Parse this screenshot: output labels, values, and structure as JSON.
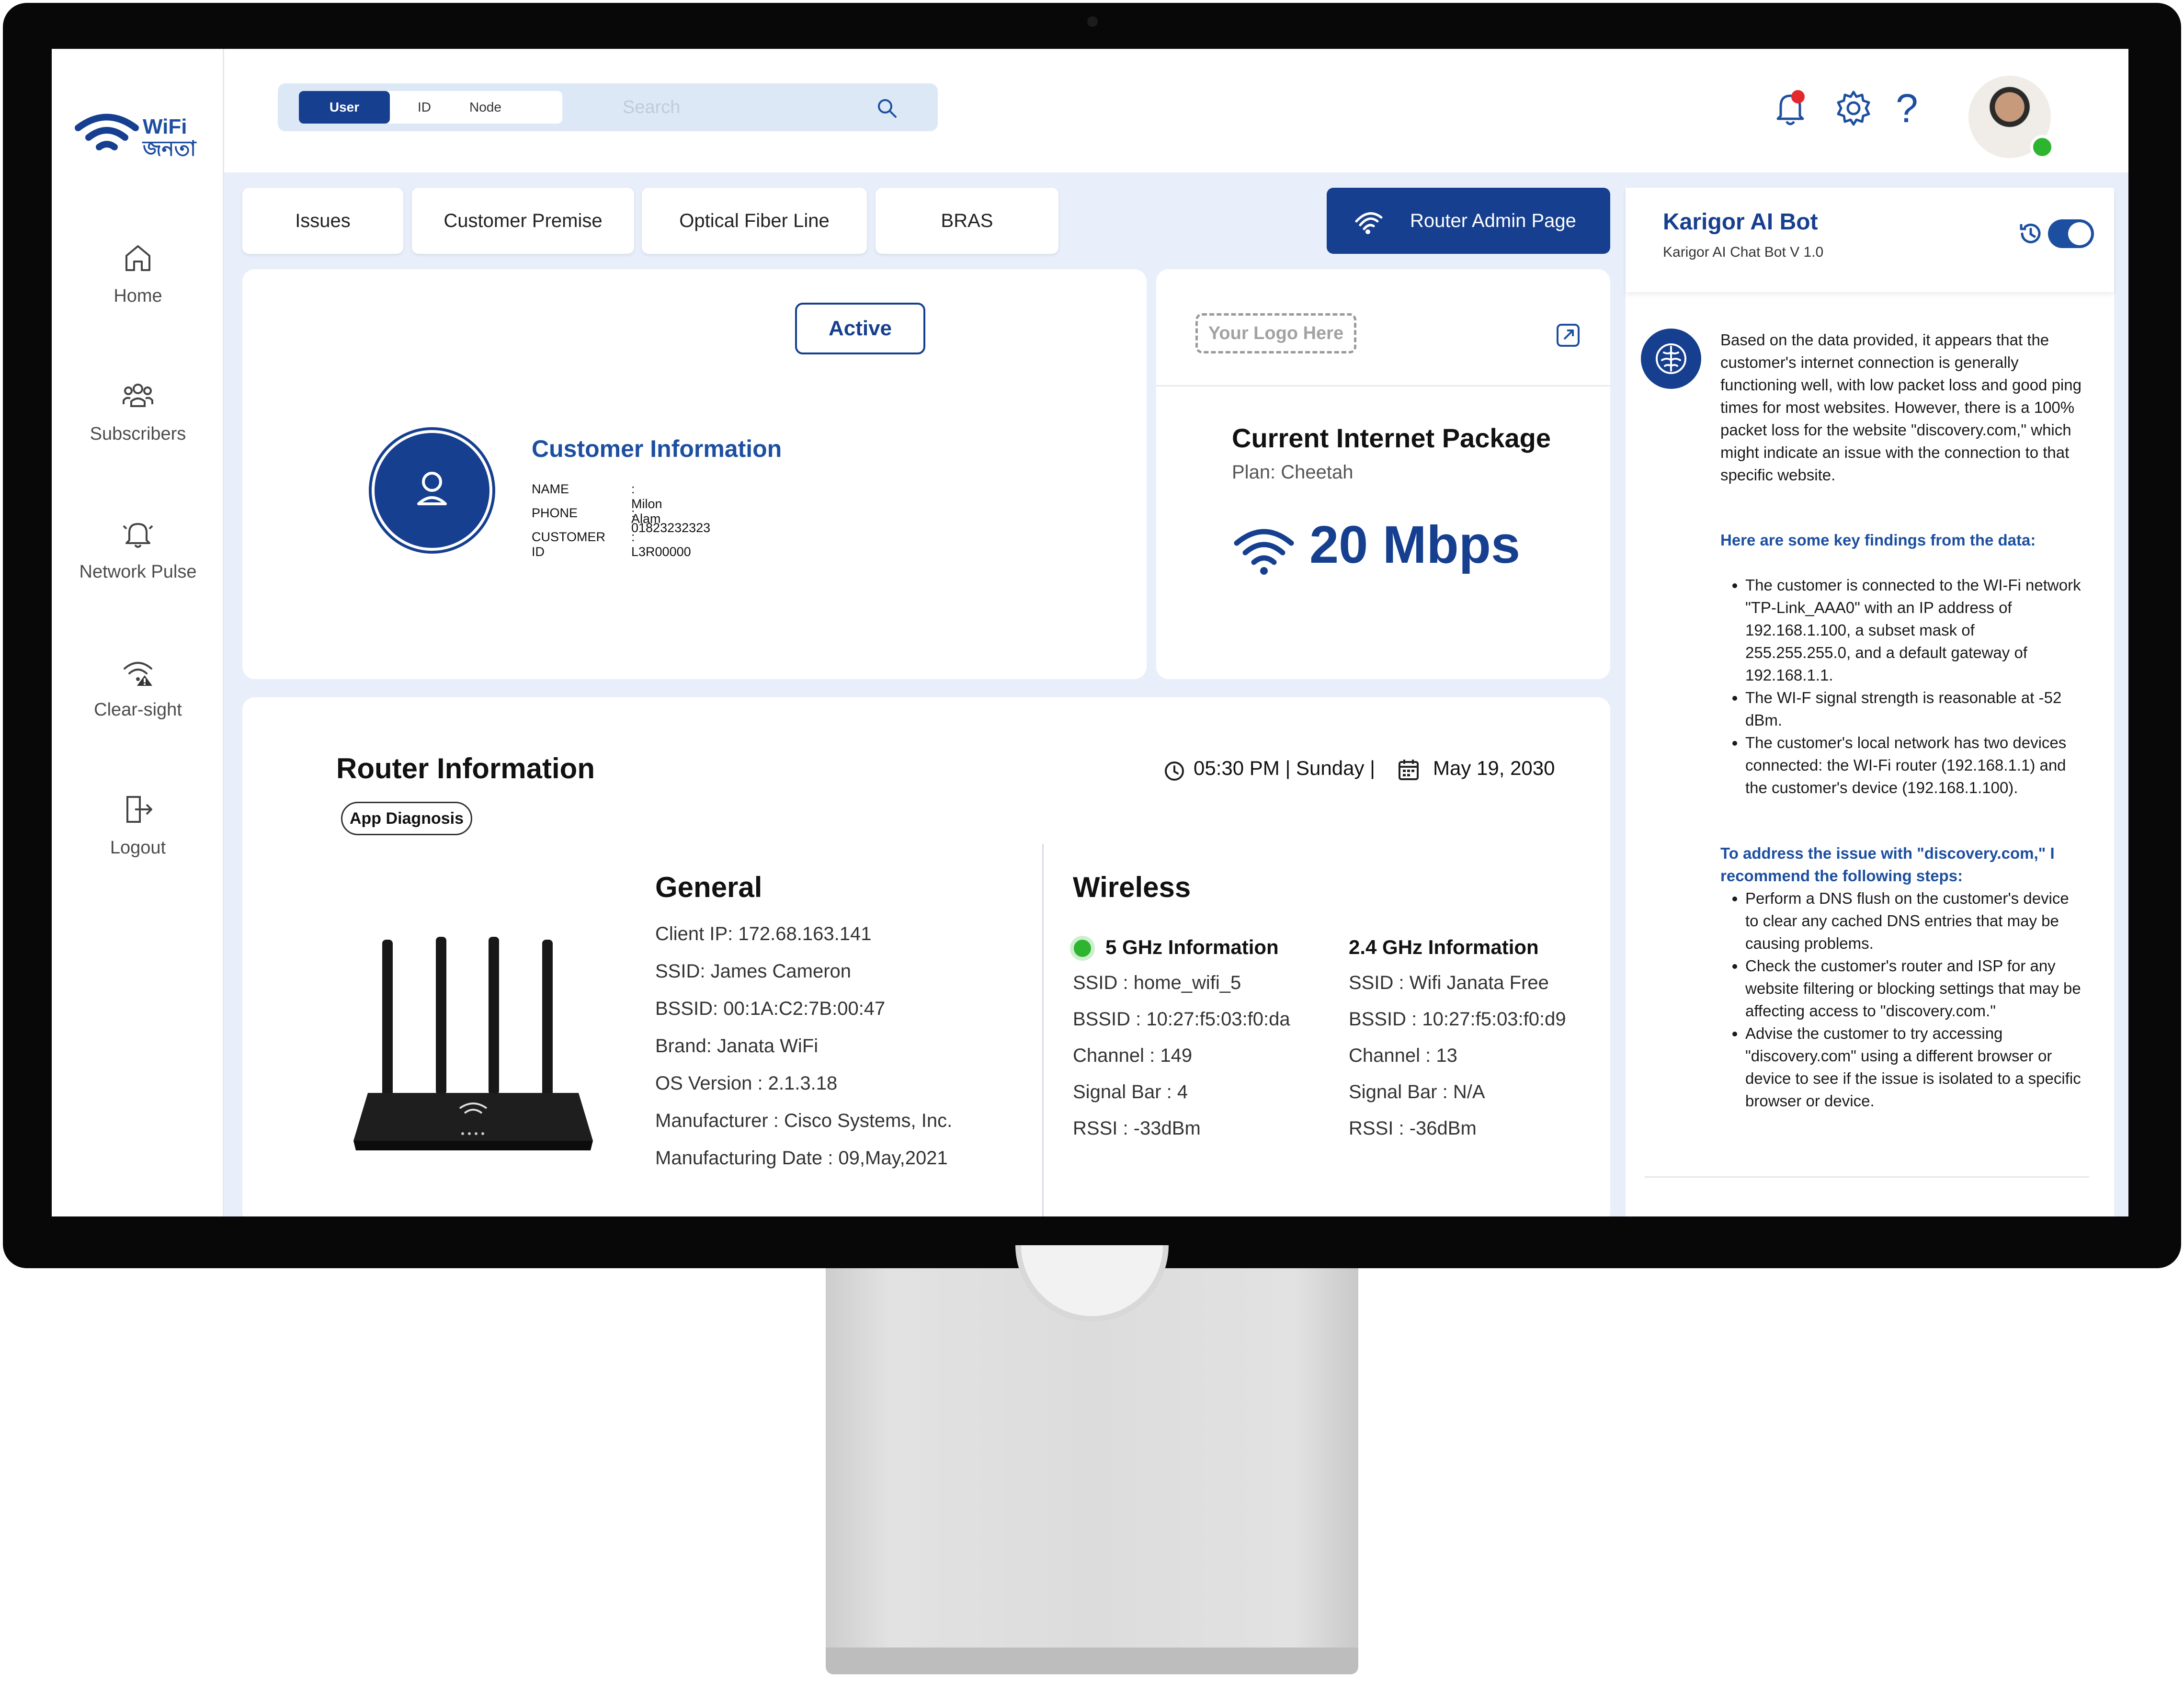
{
  "brand": {
    "logo_top": "WiFi",
    "logo_bottom": "জনতা"
  },
  "sidebar": {
    "items": [
      {
        "label": "Home",
        "icon": "home-icon"
      },
      {
        "label": "Subscribers",
        "icon": "users-icon"
      },
      {
        "label": "Network Pulse",
        "icon": "bell-pulse-icon"
      },
      {
        "label": "Clear-sight",
        "icon": "wifi-warning-icon"
      },
      {
        "label": "Logout",
        "icon": "logout-icon"
      }
    ]
  },
  "search": {
    "segments": [
      "User",
      "ID",
      "Node"
    ],
    "active_segment": "User",
    "placeholder": "Search"
  },
  "header_icons": [
    "notification-bell-icon",
    "settings-gear-icon",
    "help-icon"
  ],
  "tabs": [
    "Issues",
    "Customer Premise",
    "Optical Fiber Line",
    "BRAS"
  ],
  "router_admin_label": "Router Admin Page",
  "customer": {
    "status": "Active",
    "title": "Customer Information",
    "fields": [
      {
        "label": "NAME",
        "value": ": Milon Alam"
      },
      {
        "label": "PHONE",
        "value": ":  01823232323"
      },
      {
        "label": "CUSTOMER ID",
        "value": ":  L3R00000"
      }
    ]
  },
  "package": {
    "logo_placeholder": "Your Logo Here",
    "title": "Current Internet Package",
    "plan": "Plan: Cheetah",
    "speed": "20 Mbps"
  },
  "router": {
    "title": "Router Information",
    "badge": "App Diagnosis",
    "time": "05:30 PM | Sunday |",
    "date": "May 19, 2030",
    "general": {
      "title": "General",
      "rows": [
        "Client IP: 172.68.163.141",
        "SSID: James Cameron",
        "BSSID: 00:1A:C2:7B:00:47",
        "Brand: Janata WiFi",
        "OS Version : 2.1.3.18",
        "Manufacturer : Cisco Systems, Inc.",
        "Manufacturing Date : 09,May,2021"
      ]
    },
    "wireless": {
      "title": "Wireless",
      "ghz5": {
        "title": "5 GHz Information",
        "rows": [
          "SSID : home_wifi_5",
          "BSSID : 10:27:f5:03:f0:da",
          "Channel : 149",
          "Signal Bar : 4",
          "RSSI : -33dBm"
        ]
      },
      "ghz24": {
        "title": "2.4 GHz Information",
        "rows": [
          "SSID : Wifi Janata Free",
          "BSSID : 10:27:f5:03:f0:d9",
          "Channel : 13",
          "Signal Bar : N/A",
          "RSSI : -36dBm"
        ]
      }
    }
  },
  "bot": {
    "title": "Karigor AI Bot",
    "subtitle": "Karigor AI Chat Bot V 1.0",
    "intro": "Based on the data provided, it appears that the customer's internet connection is generally functioning well, with low packet loss and good ping times for most websites. However, there is a 100% packet loss for the website \"discovery.com,\" which might indicate an issue with the connection to that specific website.",
    "findings_title": "Here are some key findings from the data:",
    "findings": [
      "The customer is connected to the WI-Fi network \"TP-Link_AAA0\" with an IP address of 192.168.1.100, a subset mask of 255.255.255.0, and a default gateway of 192.168.1.1.",
      "The WI-F signal strength is reasonable at -52 dBm.",
      "The customer's local network has two devices connected: the WI-Fi router (192.168.1.1) and the customer's device (192.168.1.100)."
    ],
    "steps_title": "To address the issue with \"discovery.com,\" I recommend the following steps:",
    "steps": [
      "Perform a DNS flush on the customer's device to clear any cached DNS entries that may be causing problems.",
      "Check the customer's router and ISP for any website filtering or blocking settings that may be affecting access to \"discovery.com.\"",
      "Advise the customer to try accessing \"discovery.com\" using a different browser or device to see if the issue is isolated to a specific browser or device."
    ]
  },
  "colors": {
    "primary": "#163f8f",
    "accent": "#1d4fa0",
    "background": "#e8effa",
    "online": "#2db52f",
    "alert": "#e5282d"
  }
}
